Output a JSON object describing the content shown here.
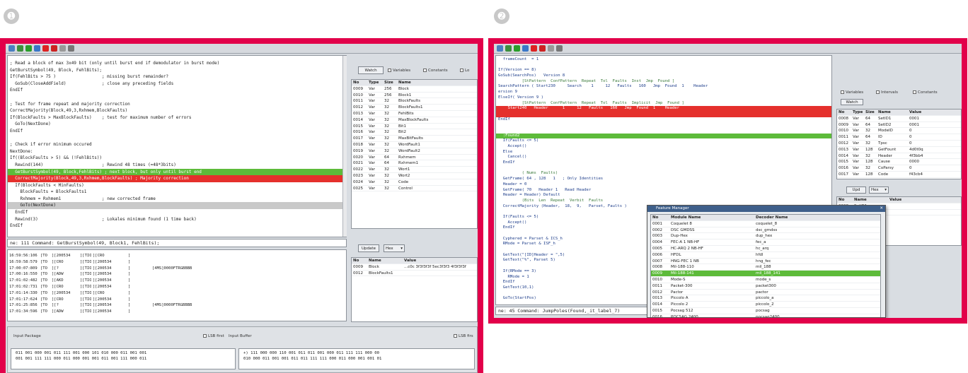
{
  "badges": [
    "➊",
    "➋"
  ],
  "colors": {
    "frame": "#e2004a",
    "highlight_green": "#5dbb3a",
    "highlight_red": "#e5302c",
    "dialog_title": "#3e5f8a"
  },
  "left": {
    "code_lines": [
      "; Read a block of max 3x49 bit (only until burst end if demodulator in burst mode)",
      "GetBurstSymbol(49, Block, FehlBits);",
      "If(FehlBits > 75 )                  ; missing burst remainder?",
      "  GoSub(CloseAddField)              ; close any preceding fields",
      "EndIf",
      "",
      "; Test for frame repeat and majority correction",
      "CorrectMajority(Block,49,3,Rxhmem,BlockFaults)",
      "If(BlockFaults > MaxBlockFaults)    ; test for maximum number of errors",
      "  GoTo(NextDone)",
      "EndIf",
      "",
      "; Check if error minimum occured",
      "NextDone:",
      "If((BlockFaults > 5) && (!FehlBits))",
      "  Rewind(144)                       ; Rewind 48 times (=48*3bits)",
      "  GetBurstSymbol(49, Block,FehlBits) ; next block, but only until burst end",
      "  CorrectMajority(Block,49,3,Rxhmem,BlockFaults) ; Majority correction",
      "  If(BlockFaults < MinFaults)",
      "    BlockFaults = BlockFaults1",
      "    Rxhmem = Rxhmem1                ; new corrected frame",
      "    GoTo(NextDone)",
      "  EndIf",
      "  Rewind(3)                         ; Lokales minimum found (1 time back)",
      "EndIf"
    ],
    "command_text": "ne: 111 Command: GetBurstSymbol(49, Block1, FehlBits);",
    "watch_label": "Watch",
    "watch_options": [
      "Variables",
      "Constants",
      "Lo"
    ],
    "watch_headers": [
      "No",
      "Type",
      "Size",
      "Name"
    ],
    "watch_rows": [
      [
        "0009",
        "Var",
        "256",
        "Block"
      ],
      [
        "0010",
        "Var",
        "256",
        "Block1"
      ],
      [
        "0011",
        "Var",
        "32",
        "BlockFaults"
      ],
      [
        "0012",
        "Var",
        "32",
        "BlockFaults1"
      ],
      [
        "0013",
        "Var",
        "32",
        "FehlBits"
      ],
      [
        "0014",
        "Var",
        "32",
        "MaxBlockFaults"
      ],
      [
        "0015",
        "Var",
        "32",
        "Bit1"
      ],
      [
        "0016",
        "Var",
        "32",
        "Bit2"
      ],
      [
        "0017",
        "Var",
        "32",
        "MaxBitFaults"
      ],
      [
        "0018",
        "Var",
        "32",
        "WordFault1"
      ],
      [
        "0019",
        "Var",
        "32",
        "WordFault2"
      ],
      [
        "0020",
        "Var",
        "64",
        "Rxhmem"
      ],
      [
        "0021",
        "Var",
        "64",
        "Rxhmem1"
      ],
      [
        "0022",
        "Var",
        "32",
        "Wort1"
      ],
      [
        "0023",
        "Var",
        "32",
        "Wort2"
      ],
      [
        "0024",
        "Var",
        "32",
        "Code"
      ],
      [
        "0025",
        "Var",
        "32",
        "Control"
      ]
    ],
    "update_label": "Update",
    "update_select": "Hex",
    "value_headers": [
      "No",
      "Name",
      "Value"
    ],
    "value_rows": [
      [
        "0009",
        "Block",
        "...c0c 3f3f3f3f 5ec3f3f3 4f3f3f3f"
      ],
      [
        "0012",
        "BlockFaults1",
        ""
      ]
    ],
    "log_rows": [
      [
        "16:59:56:106",
        "[TO",
        "][200534",
        "][TIO",
        "][CRO",
        "]",
        ""
      ],
      [
        "16:59:58:579",
        "[TO",
        "][CRO",
        "][TIO",
        "][200534",
        "]",
        ""
      ],
      [
        "17:00:07:809",
        "[TO",
        "][?",
        "][TIO",
        "][200534",
        "]",
        "[4MS]0000FTRGBBBB"
      ],
      [
        "17:00:16:550",
        "[TO",
        "][ADW",
        "][TIO",
        "][200534",
        "]",
        ""
      ],
      [
        "17:01:02:482",
        "[TO",
        "][AKD",
        "][TIO",
        "][200534",
        "]",
        ""
      ],
      [
        "17:01:02:731",
        "[TO",
        "][CRO",
        "][TIO",
        "][200534",
        "]",
        ""
      ],
      [
        "17:01:14:330",
        "[TO",
        "][200534",
        "][TIO",
        "][CRO",
        "]",
        ""
      ],
      [
        "17:01:17:624",
        "[TO",
        "][CRO",
        "][TIO",
        "][200534",
        "]",
        ""
      ],
      [
        "17:01:25:856",
        "[TO",
        "][?",
        "][TIO",
        "][200534",
        "]",
        "[4MS]0000FTRGBBBB"
      ],
      [
        "17:01:34:596",
        "[TO",
        "][ADW",
        "][TIO",
        "][200534",
        "]",
        ""
      ]
    ],
    "input_package_label": "Input Package",
    "lsb_label_1": "LSB first",
    "input_buffer_label": "Input Buffer",
    "lsb_label_2": "LSB firs",
    "bits_left": [
      "011 001 000 001 011 111 001 000 101 010 000 011 001 001",
      "001 001 111 111 000 011 000 001 001 011 001 111 000 011"
    ],
    "bits_right": [
      "+) 111 000 000 110 001 011 011 001 000 011 111 111 000 00",
      "010 000 011 001 001 011 011 111 111 000 011 000 001 001 01"
    ]
  },
  "right": {
    "code_lines": [
      {
        "t": "  frameCount  = 1",
        "c": ""
      },
      {
        "t": "",
        "c": ""
      },
      {
        "t": "If(Version == 8)",
        "c": ""
      },
      {
        "t": "GoSub(SearchPos)   Version 8",
        "c": ""
      },
      {
        "t": "          [StPattern  ConfPattern  Repeat  Tol  Faults  Inst  Jmp  Found ]",
        "c": ""
      },
      {
        "t": "SearchPattern ( Start230     Search    1     12   Faults   160   Jmp  Found  1    Header",
        "c": ""
      },
      {
        "t": "ersion 9",
        "c": ""
      },
      {
        "t": "ElseIf( Version 9 )",
        "c": ""
      },
      {
        "t": "          [StPattern  ConfPattern  Repeat  Tol  Faults  Implicit  Jmp  Found ]",
        "c": ""
      },
      {
        "t": "    Start240   Header      1     12   Faults   160   Jmp  Found  1    Header",
        "c": "r"
      },
      {
        "t": "",
        "c": "r"
      },
      {
        "t": "EndIf",
        "c": ""
      },
      {
        "t": "",
        "c": ""
      },
      {
        "t": "",
        "c": ""
      },
      {
        "t": "  :Found2",
        "c": "g"
      },
      {
        "t": "  If(Faults <= 5)",
        "c": ""
      },
      {
        "t": "    Accept()",
        "c": ""
      },
      {
        "t": "  Else",
        "c": ""
      },
      {
        "t": "    Cancel()",
        "c": ""
      },
      {
        "t": "  EndIf",
        "c": ""
      },
      {
        "t": "",
        "c": ""
      },
      {
        "t": "          ( Nums  Faults)",
        "c": ""
      },
      {
        "t": "  GetFrame( 64 , 128   1   ; Only Identities",
        "c": ""
      },
      {
        "t": "  Header = 0",
        "c": ""
      },
      {
        "t": "  GetFrame( 70   Header 1   Read Header",
        "c": ""
      },
      {
        "t": "  Header = Header) Default",
        "c": ""
      },
      {
        "t": "          (Bits  Len  Repeat  Verbit  Faults",
        "c": ""
      },
      {
        "t": "  CorrectMajority (Header,  18,  9,   Parset, Faults )",
        "c": ""
      },
      {
        "t": "",
        "c": ""
      },
      {
        "t": "  If(Faults <= 5)",
        "c": ""
      },
      {
        "t": "    Accept()",
        "c": ""
      },
      {
        "t": "  EndIf",
        "c": ""
      },
      {
        "t": "",
        "c": ""
      },
      {
        "t": "  Cyphered = Parset & ICS_h",
        "c": ""
      },
      {
        "t": "  RMode = Parset & ISF_h",
        "c": ""
      },
      {
        "t": "",
        "c": ""
      },
      {
        "t": "  GetText(\"[ID]Header = \",5)",
        "c": ""
      },
      {
        "t": "  GetText(\"%\", Parset 5)",
        "c": ""
      },
      {
        "t": "",
        "c": ""
      },
      {
        "t": "  If(RMode == 3)",
        "c": ""
      },
      {
        "t": "    RMode = 1",
        "c": ""
      },
      {
        "t": "  EndIf",
        "c": ""
      },
      {
        "t": "  GetText(10,1)",
        "c": ""
      },
      {
        "t": "",
        "c": ""
      },
      {
        "t": "  GoTo(StartPos)",
        "c": ""
      }
    ],
    "command_text": "ne: 45 Command: JumpPoles(Found,_it_label_7)",
    "variables_label": "Variables",
    "intervals_label": "Intervals",
    "constants_label": "Constants",
    "watch_label": "Watch",
    "watch_headers": [
      "No",
      "Type",
      "Size",
      "Name",
      "Value"
    ],
    "watch_rows": [
      [
        "0008",
        "Var",
        "64",
        "SetID1",
        "0001"
      ],
      [
        "0009",
        "Var",
        "64",
        "SetID2",
        "0001"
      ],
      [
        "0010",
        "Var",
        "32",
        "ModeID",
        "0"
      ],
      [
        "0011",
        "Var",
        "64",
        "ID",
        "0"
      ],
      [
        "0012",
        "Var",
        "32",
        "Tpsc",
        "0"
      ],
      [
        "0013",
        "Var",
        "128",
        "GetFount",
        "4d0t0q"
      ],
      [
        "0014",
        "Var",
        "32",
        "Header",
        "4f3bb4"
      ],
      [
        "0015",
        "Var",
        "128",
        "Cause",
        "0000"
      ],
      [
        "0016",
        "Var",
        "32",
        "CoParsy",
        "0"
      ],
      [
        "0017",
        "Var",
        "128",
        "Code",
        "f43cb4"
      ]
    ],
    "update_label": "Upd",
    "update_select": "Hex",
    "value_headers": [
      "No",
      "Name",
      "Value"
    ],
    "value_rows": [
      [
        "0008",
        "SetID1",
        ""
      ],
      [
        "0010",
        "ID",
        ""
      ]
    ],
    "dialog_title": "Feature Manager",
    "dialog_headers": [
      "No",
      "Module Name",
      "Decoder Name"
    ],
    "dialog_rows": [
      [
        "0001",
        "Coquelet 8",
        "coquelet_8"
      ],
      [
        "0002",
        "DSC GMDSS",
        "dsc_gmdss"
      ],
      [
        "0003",
        "Dup-Hex",
        "dup_hex"
      ],
      [
        "0004",
        "FEC-A 1 NB-HF",
        "fec_a"
      ],
      [
        "0005",
        "HC-ARQ 2 NB-HF",
        "hc_arq"
      ],
      [
        "0006",
        "HFDL",
        "hfdl"
      ],
      [
        "0007",
        "HNG-FEC 1 NB",
        "hng_fec"
      ],
      [
        "0008",
        "Mil-188-110",
        "mil_188"
      ],
      [
        "0009",
        "Mil-188-141",
        "mil_188_141"
      ],
      [
        "0010",
        "Mode-S",
        "mode_s"
      ],
      [
        "0011",
        "Packet-300",
        "packet300"
      ],
      [
        "0012",
        "Pactor",
        "pactor"
      ],
      [
        "0013",
        "Piccolo A",
        "piccolo_a"
      ],
      [
        "0014",
        "Piccolo 2",
        "piccolo_2"
      ],
      [
        "0015",
        "Pocsag 512",
        "pocsag"
      ],
      [
        "0016",
        "POCSAG 2400",
        "pocsag2400"
      ]
    ]
  }
}
